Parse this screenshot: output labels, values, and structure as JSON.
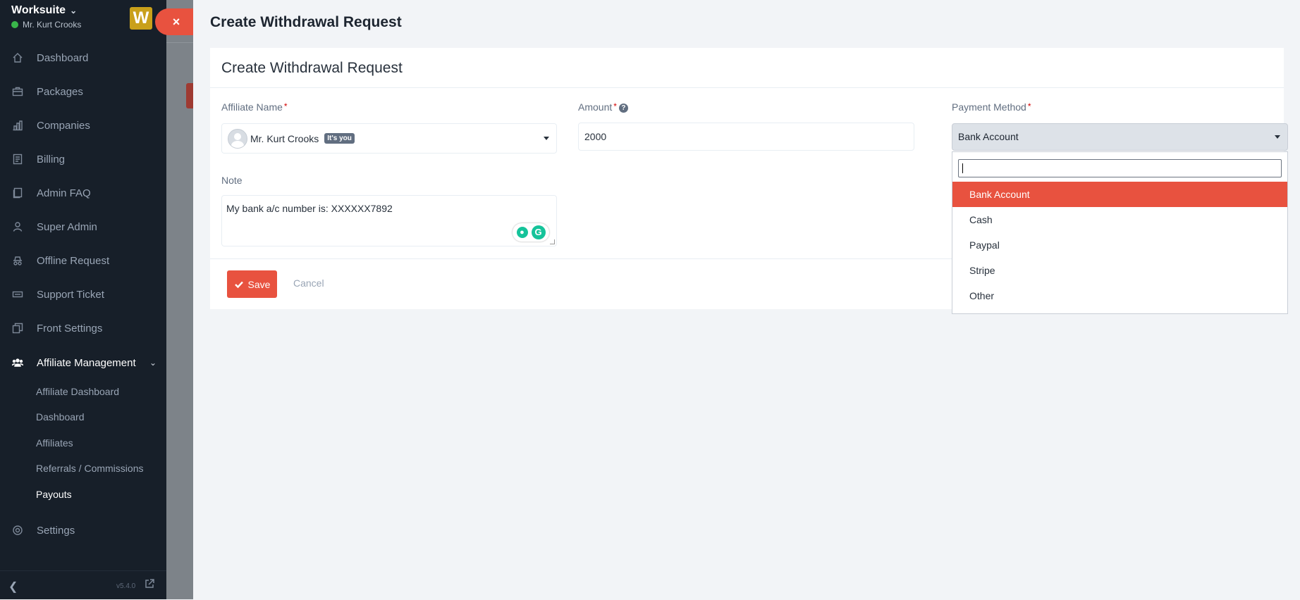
{
  "sidebar": {
    "brand": "Worksuite",
    "user": "Mr. Kurt Crooks",
    "logo_letter": "W",
    "items": [
      {
        "label": "Dashboard",
        "icon": "house-icon"
      },
      {
        "label": "Packages",
        "icon": "briefcase-icon"
      },
      {
        "label": "Companies",
        "icon": "building-icon"
      },
      {
        "label": "Billing",
        "icon": "receipt-icon"
      },
      {
        "label": "Admin FAQ",
        "icon": "document-icon"
      },
      {
        "label": "Super Admin",
        "icon": "user-icon"
      },
      {
        "label": "Offline Request",
        "icon": "incognito-icon"
      },
      {
        "label": "Support Ticket",
        "icon": "ticket-icon"
      },
      {
        "label": "Front Settings",
        "icon": "layers-icon"
      },
      {
        "label": "Affiliate Management",
        "icon": "users-icon"
      },
      {
        "label": "Settings",
        "icon": "gear-icon"
      }
    ],
    "subitems": [
      "Affiliate Dashboard",
      "Dashboard",
      "Affiliates",
      "Referrals / Commissions",
      "Payouts"
    ],
    "version": "v5.4.0"
  },
  "panel": {
    "title": "Create Withdrawal Request",
    "card_title": "Create Withdrawal Request"
  },
  "form": {
    "affiliate_label": "Affiliate Name",
    "affiliate_value": "Mr. Kurt Crooks",
    "affiliate_badge": "It's you",
    "amount_label": "Amount",
    "amount_value": "2000",
    "payment_label": "Payment Method",
    "payment_value": "Bank Account",
    "note_label": "Note",
    "note_value": "My bank a/c number is: XXXXXX7892",
    "required_mark": "*",
    "help_mark": "?"
  },
  "dropdown": {
    "options": [
      "Bank Account",
      "Cash",
      "Paypal",
      "Stripe",
      "Other"
    ],
    "selected": "Bank Account"
  },
  "buttons": {
    "save": "Save",
    "cancel": "Cancel",
    "close": "×"
  },
  "colors": {
    "accent": "#e8523f",
    "sidebar_bg": "#171f29"
  }
}
